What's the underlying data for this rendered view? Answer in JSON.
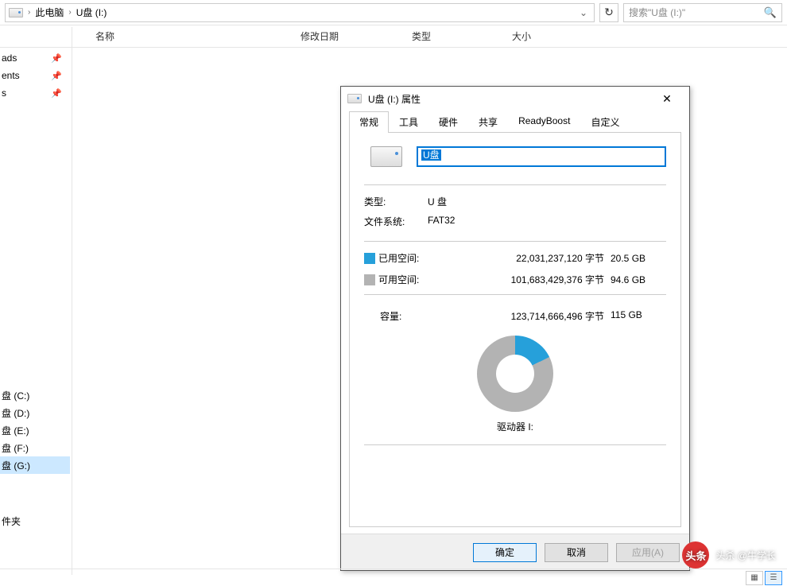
{
  "breadcrumb": {
    "l1": "此电脑",
    "l2": "U盘 (I:)"
  },
  "search": {
    "placeholder": "搜索\"U盘 (I:)\""
  },
  "columns": {
    "name": "名称",
    "date": "修改日期",
    "type": "类型",
    "size": "大小"
  },
  "nav": {
    "items": [
      "ads",
      "ents",
      "s"
    ],
    "drives": [
      "盘 (C:)",
      "盘 (D:)",
      "盘 (E:)",
      "盘 (F:)",
      "盘 (G:)"
    ],
    "folder": "件夹"
  },
  "dialog": {
    "title": "U盘 (I:) 属性",
    "tabs": [
      "常规",
      "工具",
      "硬件",
      "共享",
      "ReadyBoost",
      "自定义"
    ],
    "drive_name": "U盘",
    "type_label": "类型:",
    "type_value": "U 盘",
    "fs_label": "文件系统:",
    "fs_value": "FAT32",
    "used_label": "已用空间:",
    "used_bytes": "22,031,237,120 字节",
    "used_human": "20.5 GB",
    "free_label": "可用空间:",
    "free_bytes": "101,683,429,376 字节",
    "free_human": "94.6 GB",
    "cap_label": "容量:",
    "cap_bytes": "123,714,666,496 字节",
    "cap_human": "115 GB",
    "drive_label": "驱动器 I:",
    "ok": "确定",
    "cancel": "取消",
    "apply": "应用(A)"
  },
  "chart_data": {
    "type": "pie",
    "title": "驱动器 I:",
    "series": [
      {
        "name": "已用空间",
        "value": 20.5,
        "color": "#26a0da"
      },
      {
        "name": "可用空间",
        "value": 94.6,
        "color": "#b3b3b3"
      }
    ],
    "unit": "GB",
    "total": 115
  },
  "watermark": "头杀 @牛学长"
}
